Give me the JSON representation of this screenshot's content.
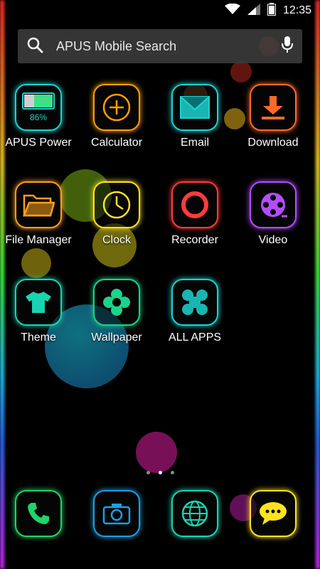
{
  "status_bar": {
    "time": "12:35"
  },
  "search": {
    "label": "APUS Mobile Search"
  },
  "battery": {
    "percent": "86%"
  },
  "apps": [
    {
      "label": "APUS Power",
      "color": "#19d4d1"
    },
    {
      "label": "Calculator",
      "color": "#ffa000"
    },
    {
      "label": "Email",
      "color": "#19d4d1"
    },
    {
      "label": "Download",
      "color": "#ff6a2a"
    },
    {
      "label": "File Manager",
      "color": "#ff9e1f"
    },
    {
      "label": "Clock",
      "color": "#ffe21f"
    },
    {
      "label": "Recorder",
      "color": "#ff3a3a"
    },
    {
      "label": "Video",
      "color": "#b34dff"
    },
    {
      "label": "Theme",
      "color": "#19d4b0"
    },
    {
      "label": "Wallpaper",
      "color": "#19d48a"
    },
    {
      "label": "ALL APPS",
      "color": "#19d4d1"
    }
  ],
  "dock": [
    {
      "name": "phone",
      "color": "#1fd46a"
    },
    {
      "name": "camera",
      "color": "#1f9ee0"
    },
    {
      "name": "browser",
      "color": "#19d4b0"
    },
    {
      "name": "messages",
      "color": "#ffe21f"
    }
  ]
}
